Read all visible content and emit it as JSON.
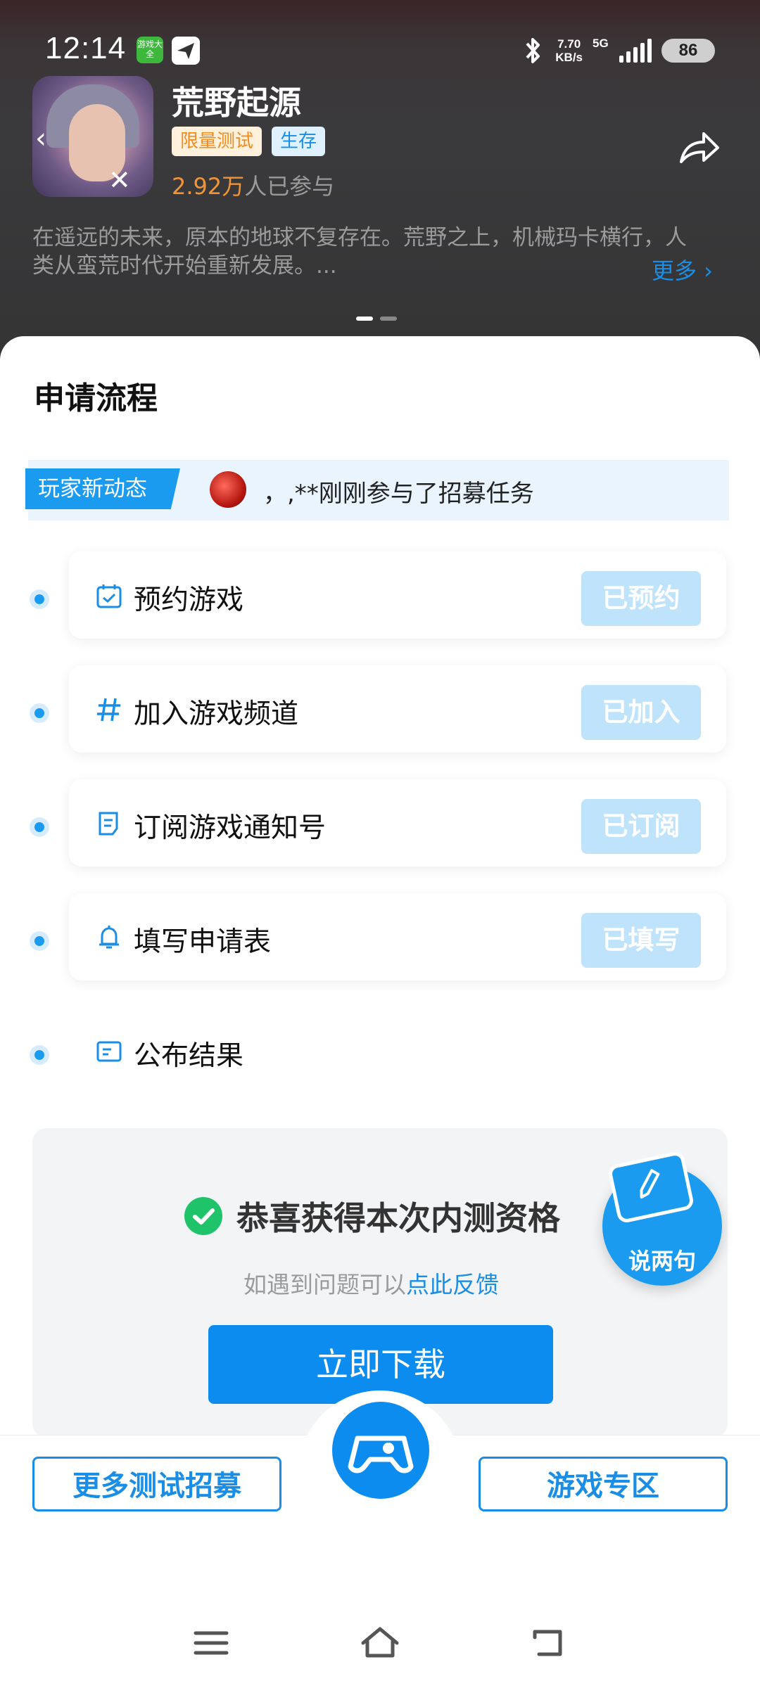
{
  "status_bar": {
    "time": "12:14",
    "app_icon_text": "游戏大全",
    "net_speed_value": "7.70",
    "net_speed_unit": "KB/s",
    "network": "5G",
    "battery": "86"
  },
  "game": {
    "title": "荒野起源",
    "tags": [
      "限量测试",
      "生存"
    ],
    "participants_num": "2.92万",
    "participants_suffix": "人已参与",
    "description": "在遥远的未来，原本的地球不复存在。荒野之上，机械玛卡横行，人类从蛮荒时代开始重新发展。...",
    "more_label": "更多 ›"
  },
  "process": {
    "title": "申请流程",
    "ticker_badge": "玩家新动态",
    "ticker_text": "，,**刚刚参与了招募任务",
    "steps": [
      {
        "label": "预约游戏",
        "status": "已预约",
        "icon": "calendar-icon"
      },
      {
        "label": "加入游戏频道",
        "status": "已加入",
        "icon": "hash-icon"
      },
      {
        "label": "订阅游戏通知号",
        "status": "已订阅",
        "icon": "notice-icon"
      },
      {
        "label": "填写申请表",
        "status": "已填写",
        "icon": "bell-icon"
      },
      {
        "label": "公布结果",
        "status": "",
        "icon": "result-icon"
      }
    ]
  },
  "result": {
    "title": "恭喜获得本次内测资格",
    "sub_text": "如遇到问题可以",
    "sub_link": "点此反馈",
    "download_label": "立即下载"
  },
  "talk_button": {
    "label": "说两句"
  },
  "bottom_bar": {
    "left_label": "更多测试招募",
    "right_label": "游戏专区"
  },
  "colors": {
    "accent": "#1a8ee6",
    "primary_button": "#0d8cf0",
    "disabled_button": "#bfe3fa",
    "success": "#1fc36a"
  }
}
